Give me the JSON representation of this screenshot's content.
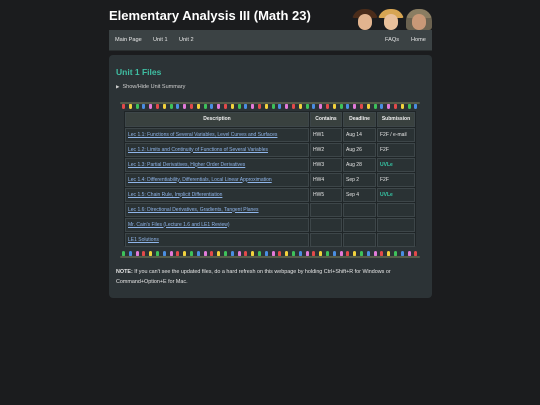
{
  "site": {
    "title": "Elementary Analysis III (Math 23)"
  },
  "nav": {
    "left": [
      {
        "label": "Main Page"
      },
      {
        "label": "Unit 1"
      },
      {
        "label": "Unit 2"
      }
    ],
    "right": [
      {
        "label": "FAQs"
      },
      {
        "label": "Home"
      }
    ]
  },
  "page": {
    "heading": "Unit 1 Files",
    "toggle_label": "Show/Hide Unit Summary",
    "toggle_icon": "triangle-right-icon"
  },
  "table": {
    "headers": [
      "Description",
      "Contains",
      "Deadline",
      "Submission"
    ],
    "rows": [
      {
        "description": "Lec 1.1: Functions of Several Variables, Level Curves and Surfaces",
        "contains": "HW1",
        "deadline": "Aug 14",
        "submission": "F2F / e-mail"
      },
      {
        "description": "Lec 1.2: Limits and Continuity of Functions of Several Variables",
        "contains": "HW2",
        "deadline": "Aug 26",
        "submission": "F2F"
      },
      {
        "description": "Lec 1.3: Partial Derivatives, Higher Order Derivatives",
        "contains": "HW3",
        "deadline": "Aug 28",
        "submission": "UVLe"
      },
      {
        "description": "Lec 1.4: Differentiability, Differentials, Local Linear Approximation",
        "contains": "HW4",
        "deadline": "Sep 2",
        "submission": "F2F"
      },
      {
        "description": "Lec 1.5: Chain Rule, Implicit Differentiation",
        "contains": "HW5",
        "deadline": "Sep 4",
        "submission": "UVLe"
      },
      {
        "description": "Lec 1.6: Directional Derivatives, Gradients, Tangent Planes",
        "contains": "",
        "deadline": "",
        "submission": ""
      },
      {
        "description": "Mr. Cain's Files (Lecture 1.6 and LE1 Review)",
        "contains": "",
        "deadline": "",
        "submission": ""
      },
      {
        "description": "LE1 Solutions",
        "contains": "",
        "deadline": "",
        "submission": ""
      }
    ]
  },
  "note": {
    "label": "NOTE:",
    "text": " If you can't see the updated files, do a hard refresh on this webpage by holding Ctrl+Shift+R for Windows or Command+Option+E for Mac."
  },
  "colors": {
    "accent": "#3fbfa3",
    "link": "#8fb5ea",
    "uvle": "#36c7a6",
    "bulbs": [
      "#e24a4a",
      "#f2d23c",
      "#3ec25a",
      "#4a8ee2",
      "#e27ad8"
    ]
  }
}
